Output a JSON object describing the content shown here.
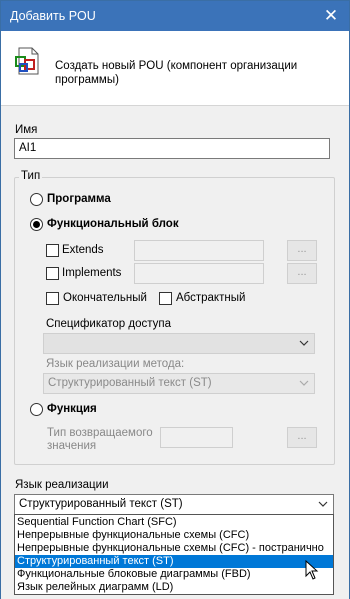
{
  "window": {
    "title": "Добавить POU"
  },
  "header": {
    "description": "Создать новый POU (компонент организации программы)"
  },
  "name_field": {
    "label": "Имя",
    "value": "AI1"
  },
  "type_group": {
    "legend": "Тип",
    "program_label": "Программа",
    "function_block_label": "Функциональный блок",
    "extends_label": "Extends",
    "implements_label": "Implements",
    "browse_label": "...",
    "final_label": "Окончательный",
    "abstract_label": "Абстрактный",
    "access_specifier_label": "Спецификатор доступа",
    "access_specifier_value": "",
    "method_language_label": "Язык реализации метода:",
    "method_language_value": "Структурированный текст (ST)",
    "function_label": "Функция",
    "return_type_label": "Тип возвращаемого значения",
    "return_type_value": "",
    "selected": "function_block"
  },
  "implementation_language": {
    "label": "Язык реализации",
    "value": "Структурированный текст (ST)",
    "options": [
      "Sequential Function Chart (SFC)",
      "Непрерывные функциональные схемы (CFC)",
      "Непрерывные функциональные схемы (CFC) - постранично",
      "Структурированный текст (ST)",
      "Функциональные блоковые диаграммы (FBD)",
      "Язык релейных диаграмм (LD)"
    ],
    "highlighted_index": 3
  },
  "icons": {
    "close": "close-icon",
    "pou": "pou-document-icon",
    "dropdown": "chevron-down-icon",
    "cursor": "mouse-pointer-icon"
  },
  "colors": {
    "titlebar": "#3b73b9",
    "selection": "#0078d7"
  }
}
